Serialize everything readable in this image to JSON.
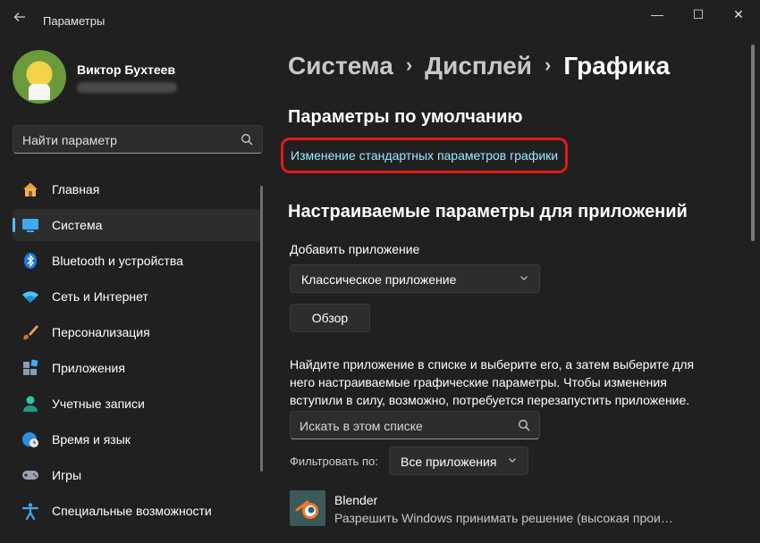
{
  "window": {
    "title": "Параметры",
    "back_icon": "arrow-left-icon",
    "minimize_glyph": "—",
    "maximize_glyph": "☐",
    "close_glyph": "✕"
  },
  "profile": {
    "name": "Виктор Бухтеев"
  },
  "search": {
    "placeholder": "Найти параметр"
  },
  "sidebar": {
    "items": [
      {
        "label": "Главная",
        "icon": "home-icon"
      },
      {
        "label": "Система",
        "icon": "system-icon",
        "active": true
      },
      {
        "label": "Bluetooth и устройства",
        "icon": "bluetooth-icon"
      },
      {
        "label": "Сеть и Интернет",
        "icon": "wifi-icon"
      },
      {
        "label": "Персонализация",
        "icon": "brush-icon"
      },
      {
        "label": "Приложения",
        "icon": "apps-icon"
      },
      {
        "label": "Учетные записи",
        "icon": "account-icon"
      },
      {
        "label": "Время и язык",
        "icon": "globe-clock-icon"
      },
      {
        "label": "Игры",
        "icon": "gamepad-icon"
      },
      {
        "label": "Специальные возможности",
        "icon": "accessibility-icon"
      }
    ]
  },
  "breadcrumb": {
    "items": [
      "Система",
      "Дисплей",
      "Графика"
    ],
    "separator": "›"
  },
  "defaults": {
    "title": "Параметры по умолчанию",
    "link": "Изменение стандартных параметров графики"
  },
  "custom": {
    "title": "Настраиваемые параметры для приложений",
    "add_label": "Добавить приложение",
    "app_type_value": "Классическое приложение",
    "browse_button": "Обзор",
    "description": "Найдите приложение в списке и выберите его, а затем выберите для него настраиваемые графические параметры. Чтобы изменения вступили в силу, возможно, потребуется перезапустить приложение.",
    "list_search_placeholder": "Искать в этом списке",
    "filter_label": "Фильтровать по:",
    "filter_value": "Все приложения"
  },
  "apps": [
    {
      "name": "Blender",
      "setting": "Разрешить Windows принимать решение (высокая прои…",
      "icon": "blender-icon"
    }
  ],
  "colors": {
    "background": "#202020",
    "accent": "#4cc2ff",
    "link": "#99ebff",
    "highlight": "#e21a1a"
  }
}
